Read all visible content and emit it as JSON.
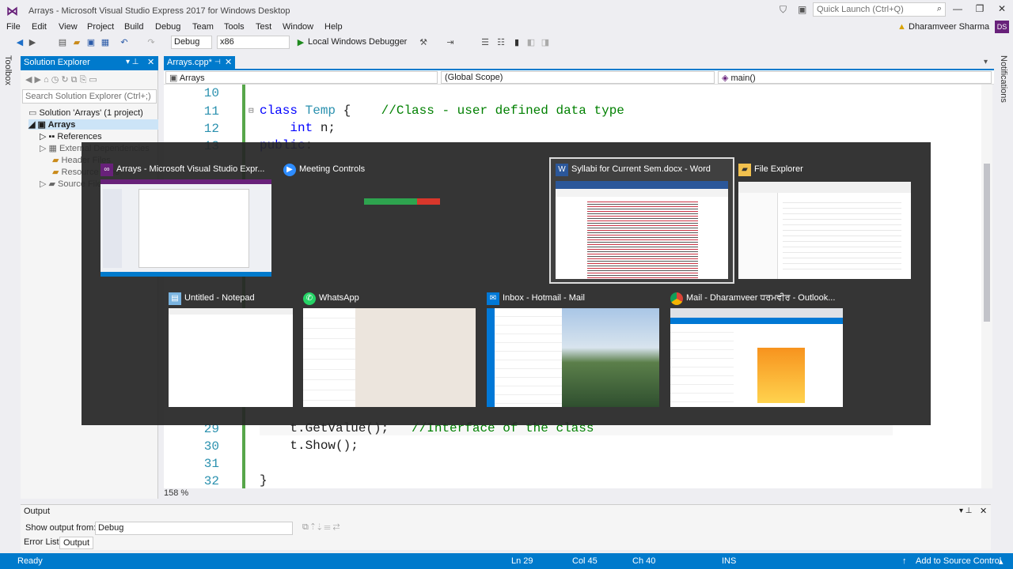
{
  "titlebar": {
    "title": "Arrays - Microsoft Visual Studio Express 2017 for Windows Desktop",
    "quick_launch_placeholder": "Quick Launch (Ctrl+Q)"
  },
  "menu": [
    "File",
    "Edit",
    "View",
    "Project",
    "Build",
    "Debug",
    "Team",
    "Tools",
    "Test",
    "Window",
    "Help"
  ],
  "user": {
    "name": "Dharamveer Sharma",
    "initials": "DS"
  },
  "toolbar": {
    "config": "Debug",
    "platform": "x86",
    "debugger": "Local Windows Debugger"
  },
  "side": {
    "toolbox": "Toolbox",
    "notifications": "Notifications"
  },
  "solution_explorer": {
    "title": "Solution Explorer",
    "search_placeholder": "Search Solution Explorer (Ctrl+;)",
    "items": [
      "Solution 'Arrays' (1 project)",
      "Arrays",
      "References",
      "External Dependencies",
      "Header Files",
      "Resource Files",
      "Source Files"
    ]
  },
  "editor": {
    "tab": "Arrays.cpp*",
    "nav_project": "Arrays",
    "nav_scope": "(Global Scope)",
    "nav_member": "main()",
    "zoom": "158 %",
    "lines": [
      {
        "n": "10",
        "code": ""
      },
      {
        "n": "11",
        "code": "class Temp {    //Class - user defined data type"
      },
      {
        "n": "12",
        "code": "    int n;"
      },
      {
        "n": "13",
        "code": "public:"
      },
      {
        "n": "29",
        "code": "    t.GetValue();   //Interface of the class"
      },
      {
        "n": "30",
        "code": "    t.Show();"
      },
      {
        "n": "31",
        "code": ""
      },
      {
        "n": "32",
        "code": "}"
      }
    ]
  },
  "output": {
    "title": "Output",
    "show_from_label": "Show output from:",
    "source": "Debug"
  },
  "bottom_tabs": [
    "Error List",
    "Output"
  ],
  "status": {
    "state": "Ready",
    "ln": "Ln 29",
    "col": "Col 45",
    "ch": "Ch 40",
    "mode": "INS",
    "source_control": "Add to Source Control"
  },
  "switcher": {
    "windows": [
      {
        "title": "Arrays - Microsoft Visual Studio Expr...",
        "icon": "visual-studio-icon",
        "color": "#68217a"
      },
      {
        "title": "Meeting Controls",
        "icon": "zoom-icon",
        "color": "#2d8cff"
      },
      {
        "title": "Syllabi for Current Sem.docx - Word",
        "icon": "word-icon",
        "color": "#2b579a"
      },
      {
        "title": "File Explorer",
        "icon": "folder-icon",
        "color": "#f2c14e"
      },
      {
        "title": "Untitled - Notepad",
        "icon": "notepad-icon",
        "color": "#7ab4e0"
      },
      {
        "title": "WhatsApp",
        "icon": "whatsapp-icon",
        "color": "#25d366"
      },
      {
        "title": "Inbox - Hotmail - Mail",
        "icon": "mail-icon",
        "color": "#0078d7"
      },
      {
        "title": "Mail - Dharamveer ਧਰਮਵੀਰ - Outlook...",
        "icon": "chrome-icon",
        "color": "#db4437"
      }
    ]
  }
}
